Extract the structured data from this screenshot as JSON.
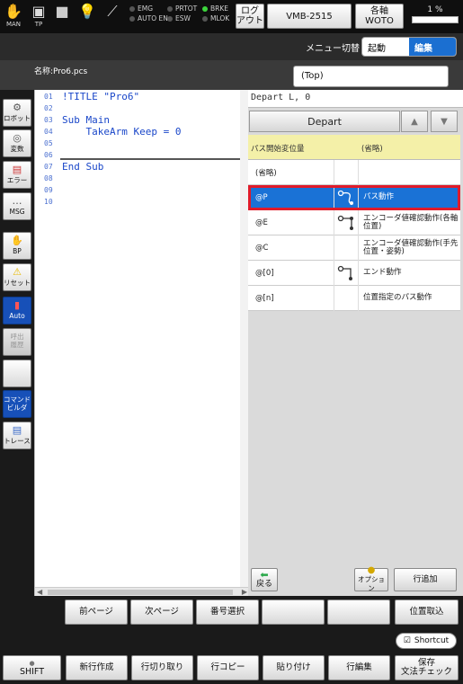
{
  "topbar": {
    "icons": [
      {
        "name": "man-icon",
        "label": "MAN"
      },
      {
        "name": "tp-icon",
        "label": "TP"
      },
      {
        "name": "stop-square-icon",
        "label": ""
      },
      {
        "name": "bulb-icon",
        "label": ""
      },
      {
        "name": "tool-icon",
        "label": ""
      }
    ],
    "status_col1": [
      "EMG",
      "AUTO EN"
    ],
    "status_col2": [
      "PRTOT",
      "ESW"
    ],
    "status_col3": [
      "BRKE",
      "MLOK"
    ],
    "logout": "ログ\nアウト",
    "model": "VMB-2515",
    "axis": "各軸\nWOTO",
    "speed": "1 %"
  },
  "menubar": {
    "label": "メニュー切替",
    "seg_run": "起動",
    "seg_edit": "編集"
  },
  "namebar": {
    "filename": "名称:Pro6.pcs",
    "top_box": "(Top)"
  },
  "sidebar": [
    {
      "name": "robot-button",
      "icon": "robot-icon",
      "label": "ロボット"
    },
    {
      "name": "variable-button",
      "icon": "variable-icon",
      "label": "変数"
    },
    {
      "name": "error-button",
      "icon": "error-icon",
      "label": "エラー"
    },
    {
      "name": "msg-button",
      "icon": "message-icon",
      "label": "MSG"
    },
    {
      "name": "bp-button",
      "icon": "hand-icon",
      "label": "BP"
    },
    {
      "name": "reset-button",
      "icon": "warning-icon",
      "label": "リセット"
    },
    {
      "name": "auto-button",
      "icon": "auto-icon",
      "label": "Auto"
    },
    {
      "name": "history-button",
      "icon": "history-icon",
      "label": "呼出\n履歴"
    },
    {
      "name": "blank-button",
      "icon": "",
      "label": ""
    },
    {
      "name": "command-builder-button",
      "icon": "",
      "label": "コマンド\nビルダ"
    },
    {
      "name": "trace-button",
      "icon": "trace-icon",
      "label": "トレース"
    }
  ],
  "editor": {
    "line_numbers": [
      "01",
      "02",
      "03",
      "04",
      "05",
      "06",
      "07",
      "08",
      "09",
      "10"
    ],
    "lines": [
      "!TITLE \"Pro6\"",
      "",
      "Sub Main",
      "    TakeArm Keep = 0",
      "",
      "",
      "End Sub",
      "",
      "",
      ""
    ]
  },
  "right": {
    "cmdline": "Depart L, 0",
    "depart": "Depart",
    "col1": "パス開始変位量",
    "col3": "(省略)",
    "rows": [
      {
        "c1": "(省略)",
        "c3": "",
        "icon": false
      },
      {
        "c1": "@P",
        "c3": "パス動作",
        "icon": true,
        "selected": true
      },
      {
        "c1": "@E",
        "c3": "エンコーダ値確認動作(各軸位置)",
        "icon": true
      },
      {
        "c1": "@C",
        "c3": "エンコーダ値確認動作(手先位置・姿勢)",
        "icon": false
      },
      {
        "c1": "@[0]",
        "c3": "エンド動作",
        "icon": true
      },
      {
        "c1": "@[n]",
        "c3": "位置指定のパス動作",
        "icon": false
      }
    ],
    "back": "戻る",
    "option": "オプション",
    "add_line": "行追加"
  },
  "bottom1": [
    "前ページ",
    "次ページ",
    "番号選択",
    "",
    "",
    "位置取込"
  ],
  "shortcut": "Shortcut",
  "bottom2": [
    "SHIFT",
    "新行作成",
    "行切り取り",
    "行コピー",
    "貼り付け",
    "行編集",
    "保存\n文法チェック"
  ]
}
